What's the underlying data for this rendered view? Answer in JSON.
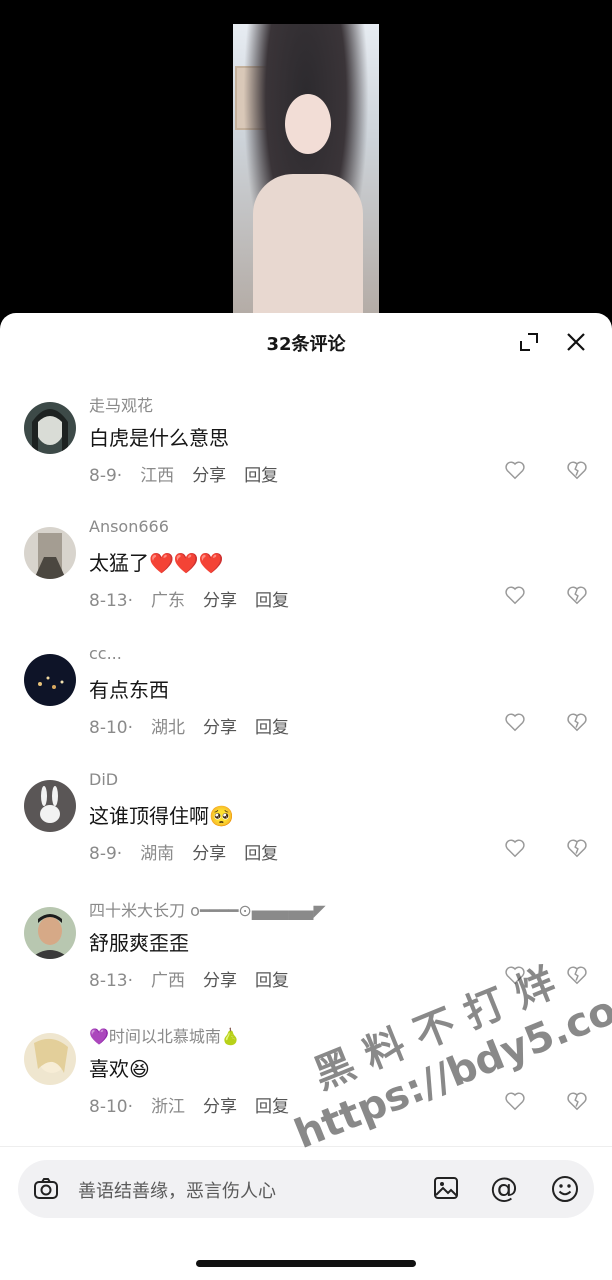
{
  "header": {
    "title": "32条评论"
  },
  "comments": [
    {
      "user": "走马观花",
      "text": "白虎是什么意思",
      "date": "8-9",
      "region": "江西",
      "share": "分享",
      "reply": "回复"
    },
    {
      "user": "Anson666",
      "text": "太猛了❤️❤️❤️",
      "date": "8-13",
      "region": "广东",
      "share": "分享",
      "reply": "回复"
    },
    {
      "user": "cc...",
      "text": "有点东西",
      "date": "8-10",
      "region": "湖北",
      "share": "分享",
      "reply": "回复"
    },
    {
      "user": "DiD",
      "text": "这谁顶得住啊🥺",
      "date": "8-9",
      "region": "湖南",
      "share": "分享",
      "reply": "回复"
    },
    {
      "user": "四十米大长刀 o━━━━⊙▄▄▄▄▄◤",
      "text": "舒服爽歪歪",
      "date": "8-13",
      "region": "广西",
      "share": "分享",
      "reply": "回复"
    },
    {
      "user": "💜时间以北慕城南🍐",
      "text": "喜欢😆",
      "date": "8-10",
      "region": "浙江",
      "share": "分享",
      "reply": "回复"
    }
  ],
  "input": {
    "placeholder": "善语结善缘，恶言伤人心"
  },
  "watermark": {
    "line1": "黑料不打烊",
    "line2": "https://bdy5.co"
  },
  "icons": {
    "expand": "expand-icon",
    "close": "close-icon",
    "like": "heart-icon",
    "dislike": "broken-heart-icon",
    "camera": "camera-icon",
    "image": "image-icon",
    "at": "at-icon",
    "emoji": "emoji-icon"
  },
  "colors": {
    "sheet": "#ffffff",
    "muted_text": "#8a8a8a",
    "body_text": "#161616",
    "input_bg": "#f1f1f3"
  }
}
